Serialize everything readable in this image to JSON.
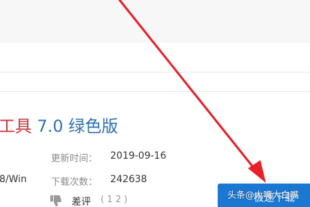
{
  "software": {
    "title_part_red": "工具",
    "title_part_blue": " 7.0 绿色版",
    "platform": "8/Win"
  },
  "meta": {
    "update_label": "更新时间：",
    "update_value": "2019-09-16",
    "downloads_label": "下载次数：",
    "downloads_value": "242638"
  },
  "rating": {
    "icon": "thumbs-down-icon",
    "label": "差评",
    "count": "( 1 2 )"
  },
  "download_button": {
    "label": "极速下载"
  },
  "watermark": {
    "text": "头条@大嘴大白嘴"
  },
  "colors": {
    "title_red": "#c7303a",
    "title_blue": "#2f6fb6",
    "button_blue": "#1a78d2",
    "arrow_red": "#e8202a"
  }
}
